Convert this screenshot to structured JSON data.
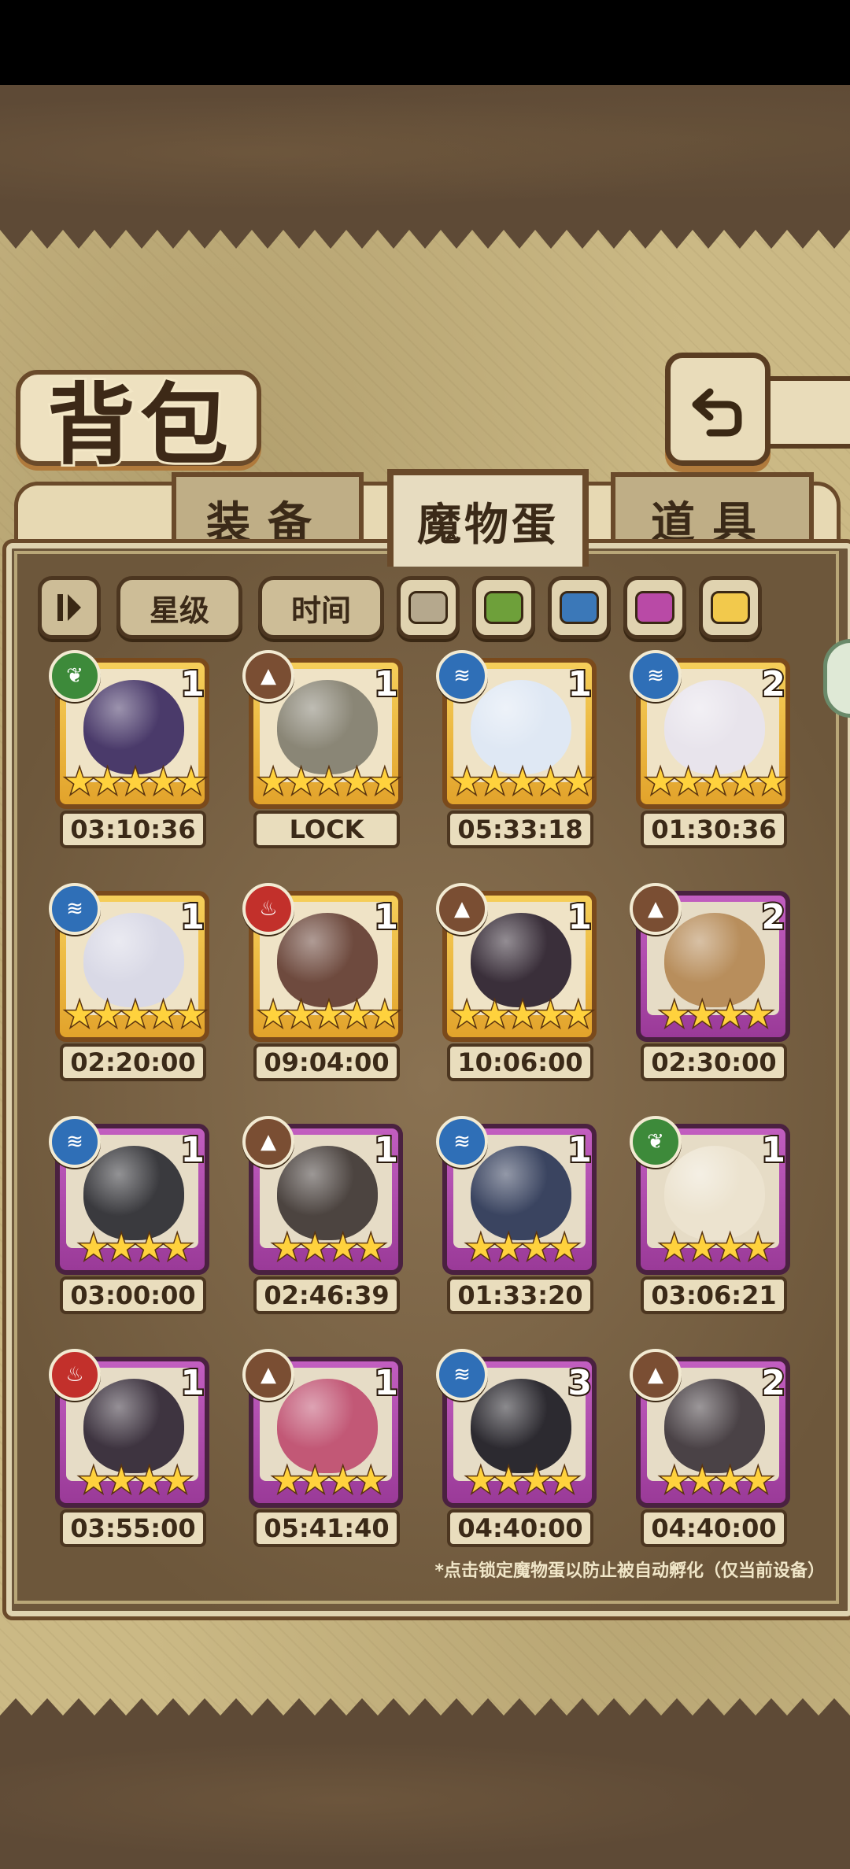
{
  "header": {
    "title": "背包"
  },
  "icons": {
    "back": "back-arrow-icon",
    "sort": "sort-toggle-icon"
  },
  "tabs": [
    {
      "label": "装备",
      "active": false
    },
    {
      "label": "魔物蛋",
      "active": true
    },
    {
      "label": "道具",
      "active": false
    }
  ],
  "filters": {
    "star_label": "星级",
    "time_label": "时间",
    "colors": [
      "#b5a88d",
      "#6ea03a",
      "#3b78b8",
      "#b94aa6",
      "#f2c94c"
    ]
  },
  "elements": {
    "nature": "leaf-icon",
    "earth": "mountain-icon",
    "water": "wave-icon",
    "fire": "flame-icon"
  },
  "eggs": [
    {
      "element": "nature",
      "count": "1",
      "stars": 5,
      "rarity": "gold",
      "timer": "03:10:36",
      "color": "#4a3a6a"
    },
    {
      "element": "earth",
      "count": "1",
      "stars": 5,
      "rarity": "gold",
      "timer": "LOCK",
      "color": "#8a8676"
    },
    {
      "element": "water",
      "count": "1",
      "stars": 5,
      "rarity": "gold",
      "timer": "05:33:18",
      "color": "#dfe8f4"
    },
    {
      "element": "water",
      "count": "2",
      "stars": 5,
      "rarity": "gold",
      "timer": "01:30:36",
      "color": "#e8e4ec"
    },
    {
      "element": "water",
      "count": "1",
      "stars": 5,
      "rarity": "gold",
      "timer": "02:20:00",
      "color": "#d9d9e6"
    },
    {
      "element": "fire",
      "count": "1",
      "stars": 5,
      "rarity": "gold",
      "timer": "09:04:00",
      "color": "#6e4a3e"
    },
    {
      "element": "earth",
      "count": "1",
      "stars": 5,
      "rarity": "gold",
      "timer": "10:06:00",
      "color": "#3a2f3a"
    },
    {
      "element": "earth",
      "count": "2",
      "stars": 4,
      "rarity": "purple",
      "timer": "02:30:00",
      "color": "#b88e5c"
    },
    {
      "element": "water",
      "count": "1",
      "stars": 4,
      "rarity": "purple",
      "timer": "03:00:00",
      "color": "#3a3a3e"
    },
    {
      "element": "earth",
      "count": "1",
      "stars": 4,
      "rarity": "purple",
      "timer": "02:46:39",
      "color": "#4c4440"
    },
    {
      "element": "water",
      "count": "1",
      "stars": 4,
      "rarity": "purple",
      "timer": "01:33:20",
      "color": "#3a4460"
    },
    {
      "element": "nature",
      "count": "1",
      "stars": 4,
      "rarity": "purple",
      "timer": "03:06:21",
      "color": "#ece3cf"
    },
    {
      "element": "fire",
      "count": "1",
      "stars": 4,
      "rarity": "purple",
      "timer": "03:55:00",
      "color": "#3e3440"
    },
    {
      "element": "earth",
      "count": "1",
      "stars": 4,
      "rarity": "purple",
      "timer": "05:41:40",
      "color": "#c25876"
    },
    {
      "element": "water",
      "count": "3",
      "stars": 4,
      "rarity": "purple",
      "timer": "04:40:00",
      "color": "#2c2a30"
    },
    {
      "element": "earth",
      "count": "2",
      "stars": 4,
      "rarity": "purple",
      "timer": "04:40:00",
      "color": "#4a4246"
    }
  ],
  "footnote": "*点击锁定魔物蛋以防止被自动孵化（仅当前设备）"
}
